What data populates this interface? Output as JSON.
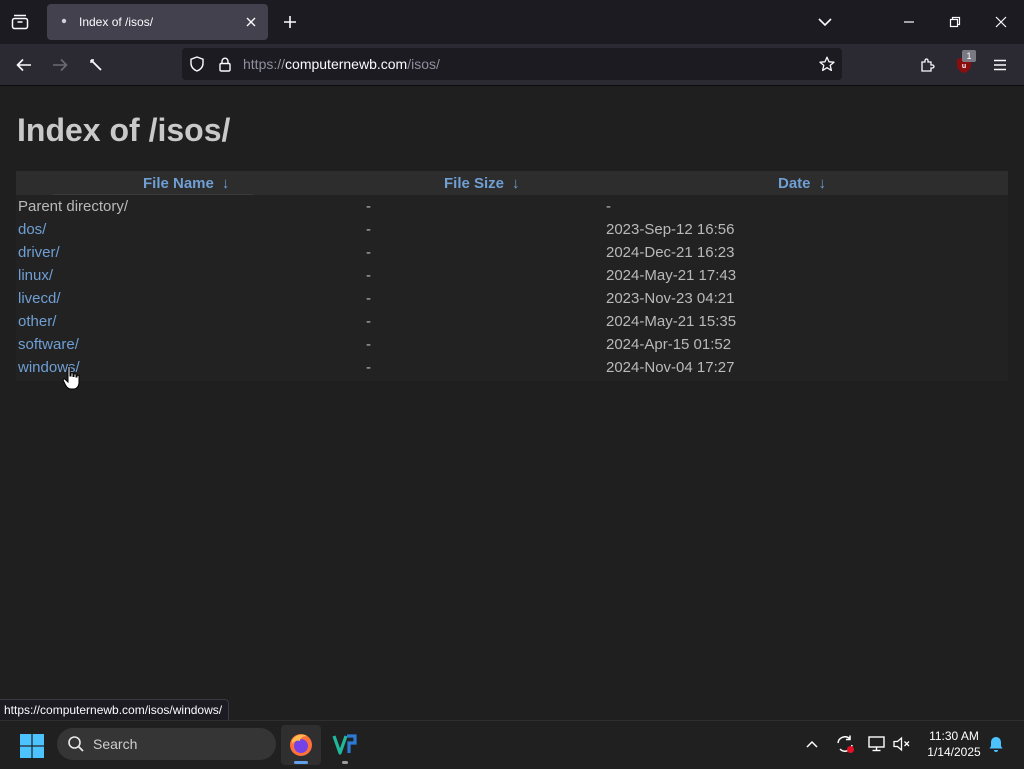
{
  "browser": {
    "tab": {
      "title": "Index of /isos/"
    },
    "url": {
      "full": "https://computernewb.com/isos/",
      "scheme": "https://",
      "host": "computernewb.com",
      "path": "/isos/"
    },
    "extension_badge": "1",
    "status_link": "https://computernewb.com/isos/windows/"
  },
  "page": {
    "title": "Index of /isos/",
    "columns": {
      "name": "File Name",
      "size": "File Size",
      "date": "Date",
      "sort_arrow": "↓"
    },
    "rows": [
      {
        "name": "Parent directory/",
        "size": "-",
        "date": "-"
      },
      {
        "name": "dos/",
        "size": "-",
        "date": "2023-Sep-12 16:56"
      },
      {
        "name": "driver/",
        "size": "-",
        "date": "2024-Dec-21 16:23"
      },
      {
        "name": "linux/",
        "size": "-",
        "date": "2024-May-21 17:43"
      },
      {
        "name": "livecd/",
        "size": "-",
        "date": "2023-Nov-23 04:21"
      },
      {
        "name": "other/",
        "size": "-",
        "date": "2024-May-21 15:35"
      },
      {
        "name": "software/",
        "size": "-",
        "date": "2024-Apr-15 01:52"
      },
      {
        "name": "windows/",
        "size": "-",
        "date": "2024-Nov-04 17:27"
      }
    ]
  },
  "taskbar": {
    "search_placeholder": "Search",
    "clock": {
      "time": "11:30 AM",
      "date": "1/14/2025"
    }
  },
  "colors": {
    "link": "#6f9fd4",
    "text": "#b9b9b9",
    "title": "#c9c9c9",
    "bg": "#1f1f1f",
    "tab_active": "#42414d",
    "accent": "#62a0ea"
  }
}
